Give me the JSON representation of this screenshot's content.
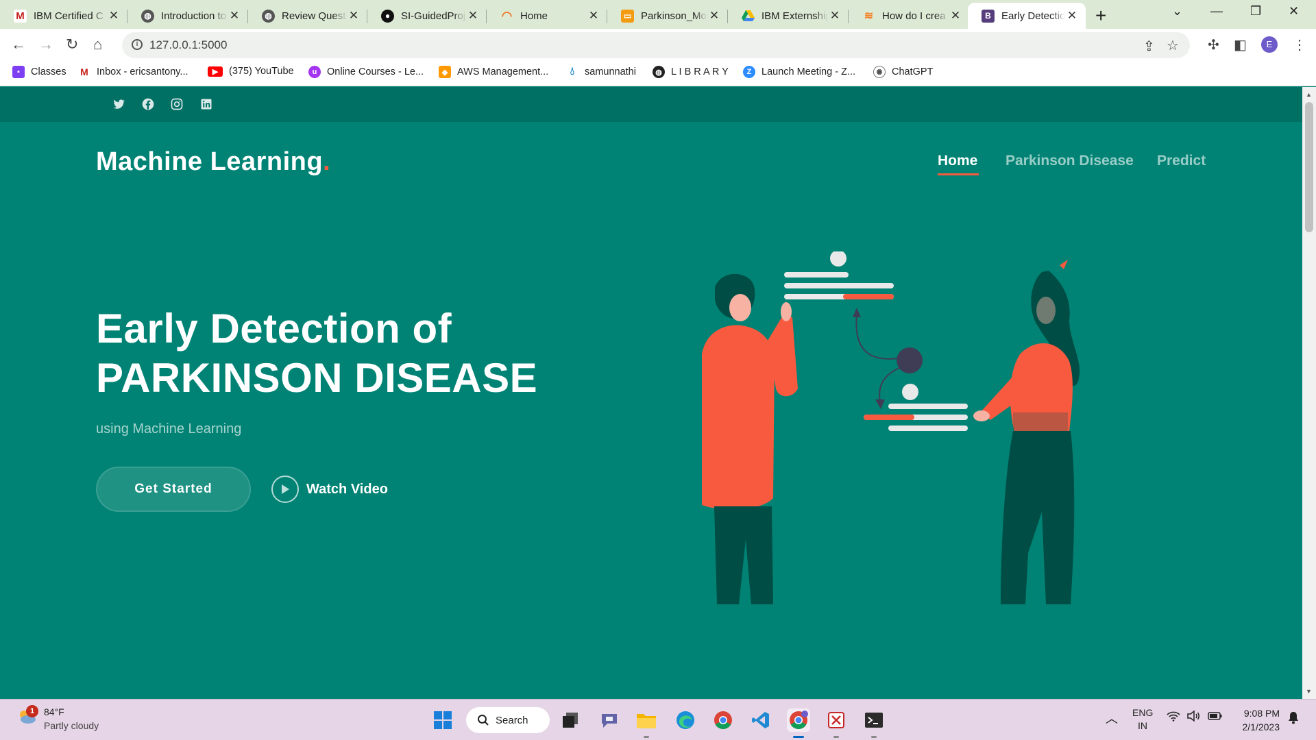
{
  "browser": {
    "tabs": [
      {
        "title": "IBM Certified C",
        "icon": "gmail-icon",
        "active": false
      },
      {
        "title": "Introduction to",
        "icon": "globe-icon",
        "active": false
      },
      {
        "title": "Review Questi",
        "icon": "globe-icon",
        "active": false
      },
      {
        "title": "SI-GuidedProje",
        "icon": "github-icon",
        "active": false
      },
      {
        "title": "Home",
        "icon": "jupyter-icon",
        "active": false
      },
      {
        "title": "Parkinson_Mo",
        "icon": "notebook-icon",
        "active": false
      },
      {
        "title": "IBM Externship",
        "icon": "google-drive-icon",
        "active": false
      },
      {
        "title": "How do I crea",
        "icon": "stackoverflow-icon",
        "active": false
      },
      {
        "title": "Early Detectio",
        "icon": "bootstrap-icon",
        "active": true
      }
    ],
    "new_tab_glyph": "+",
    "url": "127.0.0.1:5000",
    "profile_initial": "E",
    "bookmarks": [
      {
        "label": "Classes",
        "icon": "classroom-icon"
      },
      {
        "label": "Inbox - ericsantony...",
        "icon": "gmail-icon"
      },
      {
        "label": "(375) YouTube",
        "icon": "youtube-icon"
      },
      {
        "label": "Online Courses - Le...",
        "icon": "udemy-icon"
      },
      {
        "label": "AWS Management...",
        "icon": "aws-icon"
      },
      {
        "label": "samunnathi",
        "icon": "drupal-icon"
      },
      {
        "label": "L I B R A R Y",
        "icon": "globe-icon"
      },
      {
        "label": "Launch Meeting - Z...",
        "icon": "zoom-icon"
      },
      {
        "label": "ChatGPT",
        "icon": "chatgpt-icon"
      }
    ]
  },
  "site": {
    "social": [
      "twitter-icon",
      "facebook-icon",
      "instagram-icon",
      "linkedin-icon"
    ],
    "brand": "Machine Learning",
    "brand_dot": ".",
    "nav": [
      {
        "label": "Home",
        "current": true
      },
      {
        "label": "Parkinson Disease",
        "current": false
      },
      {
        "label": "Predict",
        "current": false
      }
    ],
    "hero": {
      "line1": "Early Detection of",
      "line2": "PARKINSON DISEASE",
      "subtitle": "using Machine Learning",
      "cta": "Get Started",
      "video": "Watch Video"
    },
    "colors": {
      "background": "#008374",
      "topbar": "#006f64",
      "accent": "#f85a40"
    }
  },
  "taskbar": {
    "weather_temp": "84°F",
    "weather_desc": "Partly cloudy",
    "weather_badge": "1",
    "search_label": "Search",
    "apps": [
      "start-icon",
      "task-view-icon",
      "teams-chat-icon",
      "file-explorer-icon",
      "edge-icon",
      "chrome-icon",
      "vscode-icon",
      "chrome-profile-icon",
      "snipping-tool-icon",
      "terminal-icon"
    ],
    "lang_line1": "ENG",
    "lang_line2": "IN",
    "time": "9:08 PM",
    "date": "2/1/2023"
  }
}
